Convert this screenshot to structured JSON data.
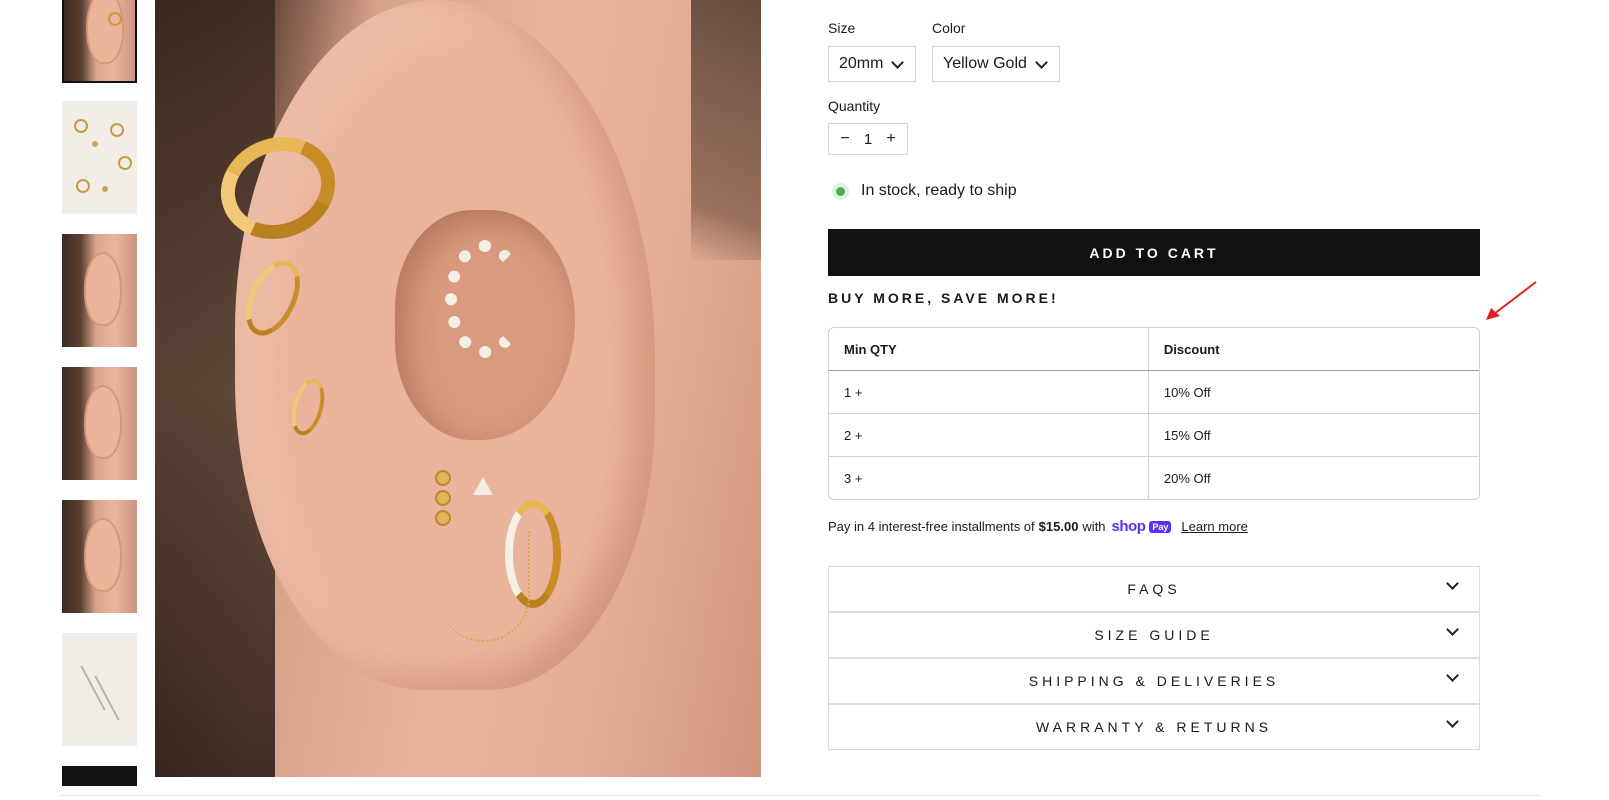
{
  "gallery": {
    "thumbnails": [
      "ear-stack-front",
      "flat-lay-pieces",
      "ear-stack-side",
      "ear-stack-closeup",
      "ear-stack-angle",
      "chain-pieces",
      "more"
    ]
  },
  "product": {
    "size_label": "Size",
    "size_value": "20mm",
    "color_label": "Color",
    "color_value": "Yellow Gold",
    "quantity_label": "Quantity",
    "quantity_value": "1",
    "qty_minus": "−",
    "qty_plus": "+",
    "stock_text": "In stock, ready to ship",
    "add_to_cart": "ADD TO CART"
  },
  "promo": {
    "heading": "BUY MORE, SAVE MORE!",
    "table_headers": [
      "Min QTY",
      "Discount"
    ],
    "rows": [
      [
        "1 +",
        "10% Off"
      ],
      [
        "2 +",
        "15% Off"
      ],
      [
        "3 +",
        "20% Off"
      ]
    ]
  },
  "payment": {
    "text_before": "Pay in 4 interest-free installments of",
    "amount": "$15.00",
    "text_with": "with",
    "brand": "shop",
    "brand_badge": "Pay",
    "learn_more": "Learn more"
  },
  "accordions": [
    "FAQS",
    "SIZE GUIDE",
    "SHIPPING & DELIVERIES",
    "WARRANTY & RETURNS"
  ],
  "colors": {
    "button_bg": "#111111",
    "stock_dot": "#4caf50",
    "shop_pay": "#5a31f4",
    "annotation_arrow": "#e02020"
  }
}
